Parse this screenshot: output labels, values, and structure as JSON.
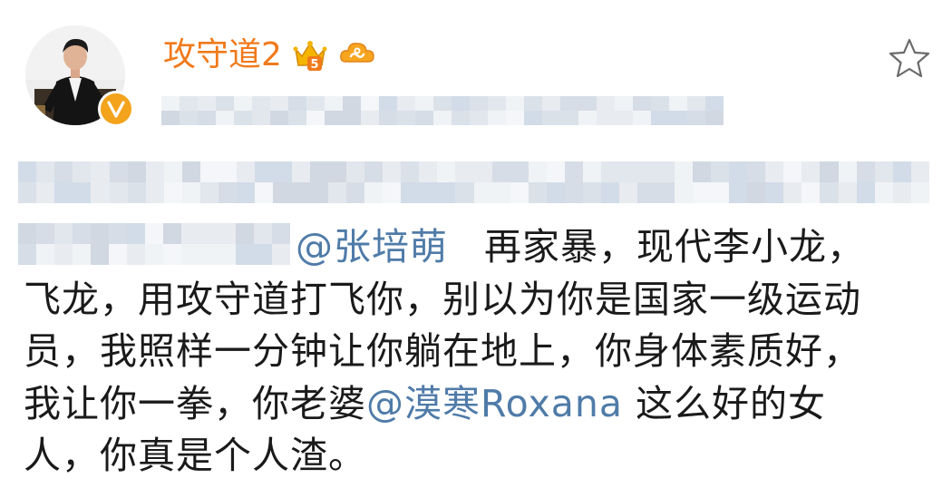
{
  "post": {
    "username": "攻守道2",
    "level_badge": "5",
    "badges": [
      "crown-vip-icon",
      "cloud-icon"
    ],
    "verified": true,
    "accent_color": "#f07a1b",
    "mention_color": "#4f7ba8",
    "body": {
      "mention1": "@张培萌",
      "text1": "再家暴，现代李小龙，",
      "text2": "飞龙，用攻守道打飞你，别以为你是国家一级运动",
      "text3": "员，我照样一分钟让你躺在地上，你身体素质好，",
      "text4": "我让你一拳，你老婆",
      "mention2": "@漠寒Roxana",
      "text5": " 这么好的女",
      "text6": "人，你真是个人渣。"
    }
  },
  "icons": {
    "favorite": "star-outline-icon",
    "verified": "verified-v-icon"
  }
}
